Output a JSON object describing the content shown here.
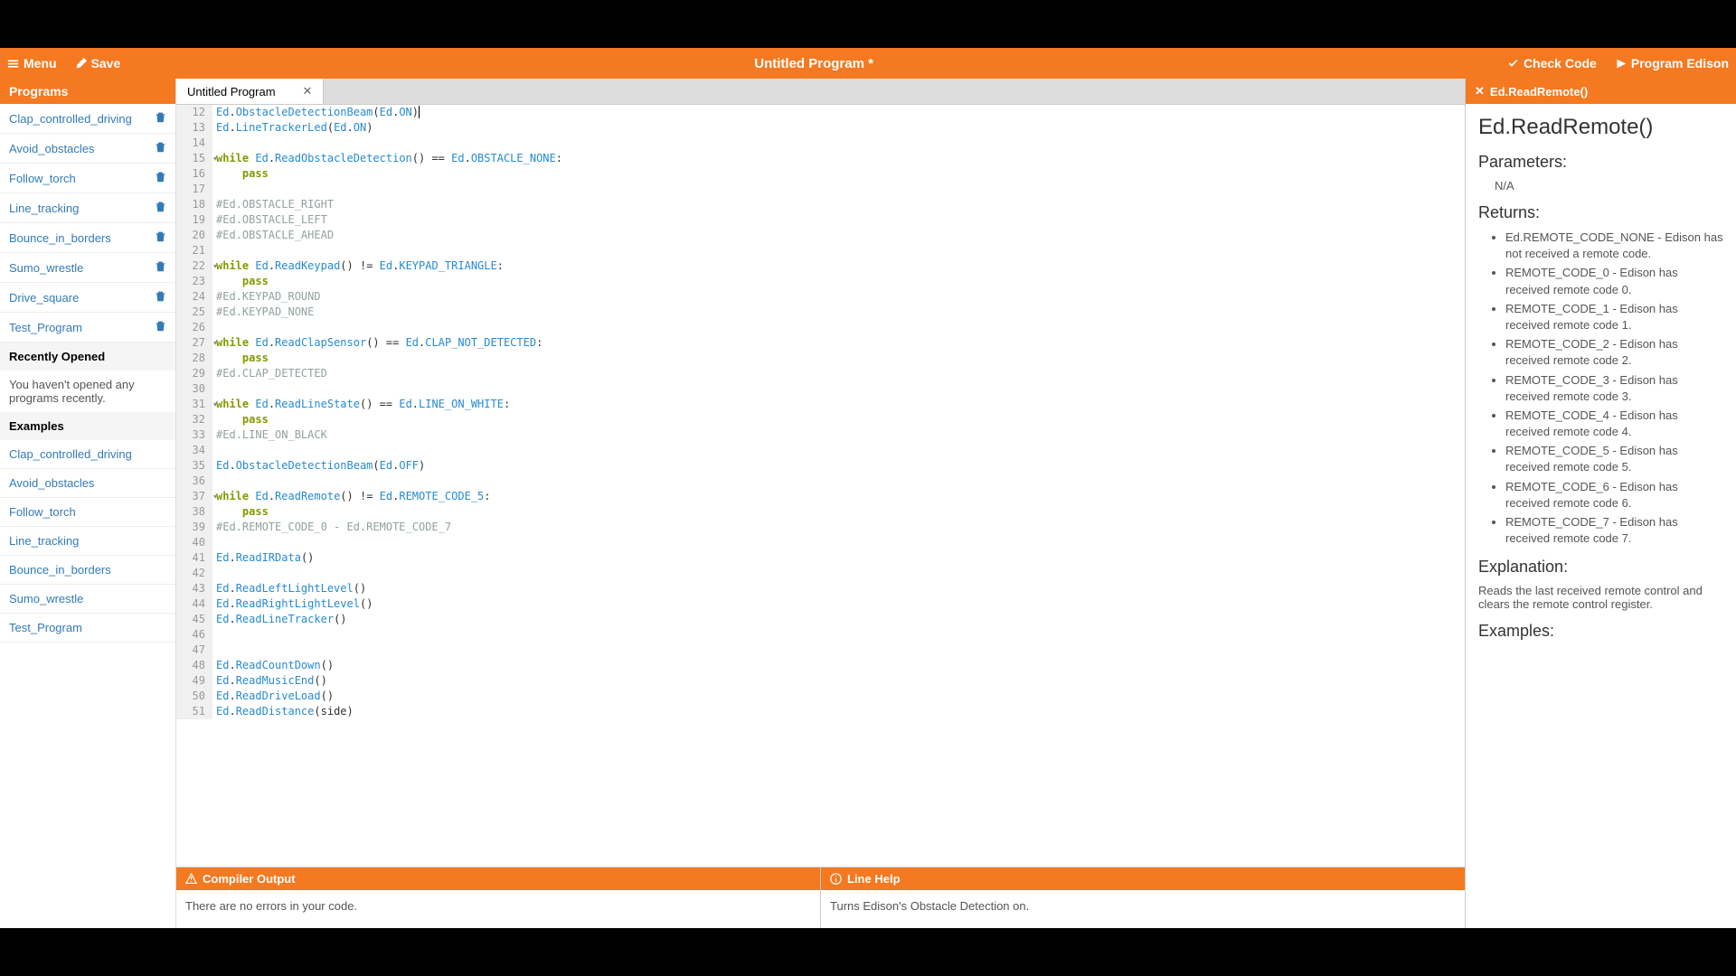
{
  "topbar": {
    "menu": "Menu",
    "save": "Save",
    "title": "Untitled Program *",
    "check": "Check Code",
    "program": "Program Edison"
  },
  "sidebar": {
    "programs_header": "Programs",
    "programs": [
      "Clap_controlled_driving",
      "Avoid_obstacles",
      "Follow_torch",
      "Line_tracking",
      "Bounce_in_borders",
      "Sumo_wrestle",
      "Drive_square",
      "Test_Program"
    ],
    "recent_header": "Recently Opened",
    "recent_text": "You haven't opened any programs recently.",
    "examples_header": "Examples",
    "examples": [
      "Clap_controlled_driving",
      "Avoid_obstacles",
      "Follow_torch",
      "Line_tracking",
      "Bounce_in_borders",
      "Sumo_wrestle",
      "Test_Program"
    ]
  },
  "tab": {
    "label": "Untitled Program"
  },
  "code": [
    {
      "n": 12,
      "tokens": [
        [
          "ed",
          "Ed"
        ],
        [
          "text",
          "."
        ],
        [
          "fn",
          "ObstacleDetectionBeam"
        ],
        [
          "text",
          "("
        ],
        [
          "ed",
          "Ed"
        ],
        [
          "text",
          "."
        ],
        [
          "const",
          "ON"
        ],
        [
          "text",
          ")"
        ]
      ],
      "cursor": true
    },
    {
      "n": 13,
      "tokens": [
        [
          "ed",
          "Ed"
        ],
        [
          "text",
          "."
        ],
        [
          "fn",
          "LineTrackerLed"
        ],
        [
          "text",
          "("
        ],
        [
          "ed",
          "Ed"
        ],
        [
          "text",
          "."
        ],
        [
          "const",
          "ON"
        ],
        [
          "text",
          ")"
        ]
      ]
    },
    {
      "n": 14,
      "tokens": []
    },
    {
      "n": 15,
      "fold": true,
      "tokens": [
        [
          "kw",
          "while"
        ],
        [
          "text",
          " "
        ],
        [
          "ed",
          "Ed"
        ],
        [
          "text",
          "."
        ],
        [
          "fn",
          "ReadObstacleDetection"
        ],
        [
          "text",
          "() "
        ],
        [
          "op",
          "=="
        ],
        [
          "text",
          " "
        ],
        [
          "ed",
          "Ed"
        ],
        [
          "text",
          "."
        ],
        [
          "const",
          "OBSTACLE_NONE"
        ],
        [
          "text",
          ":"
        ]
      ]
    },
    {
      "n": 16,
      "tokens": [
        [
          "text",
          "    "
        ],
        [
          "kw",
          "pass"
        ]
      ]
    },
    {
      "n": 17,
      "tokens": []
    },
    {
      "n": 18,
      "tokens": [
        [
          "comment",
          "#Ed.OBSTACLE_RIGHT"
        ]
      ]
    },
    {
      "n": 19,
      "tokens": [
        [
          "comment",
          "#Ed.OBSTACLE_LEFT"
        ]
      ]
    },
    {
      "n": 20,
      "tokens": [
        [
          "comment",
          "#Ed.OBSTACLE_AHEAD"
        ]
      ]
    },
    {
      "n": 21,
      "tokens": []
    },
    {
      "n": 22,
      "fold": true,
      "tokens": [
        [
          "kw",
          "while"
        ],
        [
          "text",
          " "
        ],
        [
          "ed",
          "Ed"
        ],
        [
          "text",
          "."
        ],
        [
          "fn",
          "ReadKeypad"
        ],
        [
          "text",
          "() "
        ],
        [
          "op",
          "!="
        ],
        [
          "text",
          " "
        ],
        [
          "ed",
          "Ed"
        ],
        [
          "text",
          "."
        ],
        [
          "const",
          "KEYPAD_TRIANGLE"
        ],
        [
          "text",
          ":"
        ]
      ]
    },
    {
      "n": 23,
      "tokens": [
        [
          "text",
          "    "
        ],
        [
          "kw",
          "pass"
        ]
      ]
    },
    {
      "n": 24,
      "tokens": [
        [
          "comment",
          "#Ed.KEYPAD_ROUND"
        ]
      ]
    },
    {
      "n": 25,
      "tokens": [
        [
          "comment",
          "#Ed.KEYPAD_NONE"
        ]
      ]
    },
    {
      "n": 26,
      "tokens": []
    },
    {
      "n": 27,
      "fold": true,
      "tokens": [
        [
          "kw",
          "while"
        ],
        [
          "text",
          " "
        ],
        [
          "ed",
          "Ed"
        ],
        [
          "text",
          "."
        ],
        [
          "fn",
          "ReadClapSensor"
        ],
        [
          "text",
          "() "
        ],
        [
          "op",
          "=="
        ],
        [
          "text",
          " "
        ],
        [
          "ed",
          "Ed"
        ],
        [
          "text",
          "."
        ],
        [
          "const",
          "CLAP_NOT_DETECTED"
        ],
        [
          "text",
          ":"
        ]
      ]
    },
    {
      "n": 28,
      "tokens": [
        [
          "text",
          "    "
        ],
        [
          "kw",
          "pass"
        ]
      ]
    },
    {
      "n": 29,
      "tokens": [
        [
          "comment",
          "#Ed.CLAP_DETECTED"
        ]
      ]
    },
    {
      "n": 30,
      "tokens": []
    },
    {
      "n": 31,
      "fold": true,
      "tokens": [
        [
          "kw",
          "while"
        ],
        [
          "text",
          " "
        ],
        [
          "ed",
          "Ed"
        ],
        [
          "text",
          "."
        ],
        [
          "fn",
          "ReadLineState"
        ],
        [
          "text",
          "() "
        ],
        [
          "op",
          "=="
        ],
        [
          "text",
          " "
        ],
        [
          "ed",
          "Ed"
        ],
        [
          "text",
          "."
        ],
        [
          "const",
          "LINE_ON_WHITE"
        ],
        [
          "text",
          ":"
        ]
      ]
    },
    {
      "n": 32,
      "tokens": [
        [
          "text",
          "    "
        ],
        [
          "kw",
          "pass"
        ]
      ]
    },
    {
      "n": 33,
      "tokens": [
        [
          "comment",
          "#Ed.LINE_ON_BLACK"
        ]
      ]
    },
    {
      "n": 34,
      "tokens": []
    },
    {
      "n": 35,
      "tokens": [
        [
          "ed",
          "Ed"
        ],
        [
          "text",
          "."
        ],
        [
          "fn",
          "ObstacleDetectionBeam"
        ],
        [
          "text",
          "("
        ],
        [
          "ed",
          "Ed"
        ],
        [
          "text",
          "."
        ],
        [
          "const",
          "OFF"
        ],
        [
          "text",
          ")"
        ]
      ]
    },
    {
      "n": 36,
      "tokens": []
    },
    {
      "n": 37,
      "fold": true,
      "tokens": [
        [
          "kw",
          "while"
        ],
        [
          "text",
          " "
        ],
        [
          "ed",
          "Ed"
        ],
        [
          "text",
          "."
        ],
        [
          "fn",
          "ReadRemote"
        ],
        [
          "text",
          "() "
        ],
        [
          "op",
          "!="
        ],
        [
          "text",
          " "
        ],
        [
          "ed",
          "Ed"
        ],
        [
          "text",
          "."
        ],
        [
          "const",
          "REMOTE_CODE_5"
        ],
        [
          "text",
          ":"
        ]
      ]
    },
    {
      "n": 38,
      "tokens": [
        [
          "text",
          "    "
        ],
        [
          "kw",
          "pass"
        ]
      ]
    },
    {
      "n": 39,
      "tokens": [
        [
          "comment",
          "#Ed.REMOTE_CODE_0 - Ed.REMOTE_CODE_7"
        ]
      ]
    },
    {
      "n": 40,
      "tokens": []
    },
    {
      "n": 41,
      "tokens": [
        [
          "ed",
          "Ed"
        ],
        [
          "text",
          "."
        ],
        [
          "fn",
          "ReadIRData"
        ],
        [
          "text",
          "()"
        ]
      ]
    },
    {
      "n": 42,
      "tokens": []
    },
    {
      "n": 43,
      "tokens": [
        [
          "ed",
          "Ed"
        ],
        [
          "text",
          "."
        ],
        [
          "fn",
          "ReadLeftLightLevel"
        ],
        [
          "text",
          "()"
        ]
      ]
    },
    {
      "n": 44,
      "tokens": [
        [
          "ed",
          "Ed"
        ],
        [
          "text",
          "."
        ],
        [
          "fn",
          "ReadRightLightLevel"
        ],
        [
          "text",
          "()"
        ]
      ]
    },
    {
      "n": 45,
      "tokens": [
        [
          "ed",
          "Ed"
        ],
        [
          "text",
          "."
        ],
        [
          "fn",
          "ReadLineTracker"
        ],
        [
          "text",
          "()"
        ]
      ]
    },
    {
      "n": 46,
      "tokens": []
    },
    {
      "n": 47,
      "tokens": []
    },
    {
      "n": 48,
      "tokens": [
        [
          "ed",
          "Ed"
        ],
        [
          "text",
          "."
        ],
        [
          "fn",
          "ReadCountDown"
        ],
        [
          "text",
          "()"
        ]
      ]
    },
    {
      "n": 49,
      "tokens": [
        [
          "ed",
          "Ed"
        ],
        [
          "text",
          "."
        ],
        [
          "fn",
          "ReadMusicEnd"
        ],
        [
          "text",
          "()"
        ]
      ]
    },
    {
      "n": 50,
      "tokens": [
        [
          "ed",
          "Ed"
        ],
        [
          "text",
          "."
        ],
        [
          "fn",
          "ReadDriveLoad"
        ],
        [
          "text",
          "()"
        ]
      ]
    },
    {
      "n": 51,
      "tokens": [
        [
          "ed",
          "Ed"
        ],
        [
          "text",
          "."
        ],
        [
          "fn",
          "ReadDistance"
        ],
        [
          "text",
          "(side)"
        ]
      ]
    }
  ],
  "compiler": {
    "header": "Compiler Output",
    "body": "There are no errors in your code."
  },
  "linehelp": {
    "header": "Line Help",
    "body": "Turns Edison's Obstacle Detection on."
  },
  "doc": {
    "title_header": "Ed.ReadRemote()",
    "title": "Ed.ReadRemote()",
    "params_h": "Parameters:",
    "params": "N/A",
    "returns_h": "Returns:",
    "returns": [
      "Ed.REMOTE_CODE_NONE - Edison has not received a remote code.",
      "REMOTE_CODE_0 - Edison has received remote code 0.",
      "REMOTE_CODE_1 - Edison has received remote code 1.",
      "REMOTE_CODE_2 - Edison has received remote code 2.",
      "REMOTE_CODE_3 - Edison has received remote code 3.",
      "REMOTE_CODE_4 - Edison has received remote code 4.",
      "REMOTE_CODE_5 - Edison has received remote code 5.",
      "REMOTE_CODE_6 - Edison has received remote code 6.",
      "REMOTE_CODE_7 - Edison has received remote code 7."
    ],
    "explanation_h": "Explanation:",
    "explanation": "Reads the last received remote control and clears the remote control register.",
    "examples_h": "Examples:"
  }
}
